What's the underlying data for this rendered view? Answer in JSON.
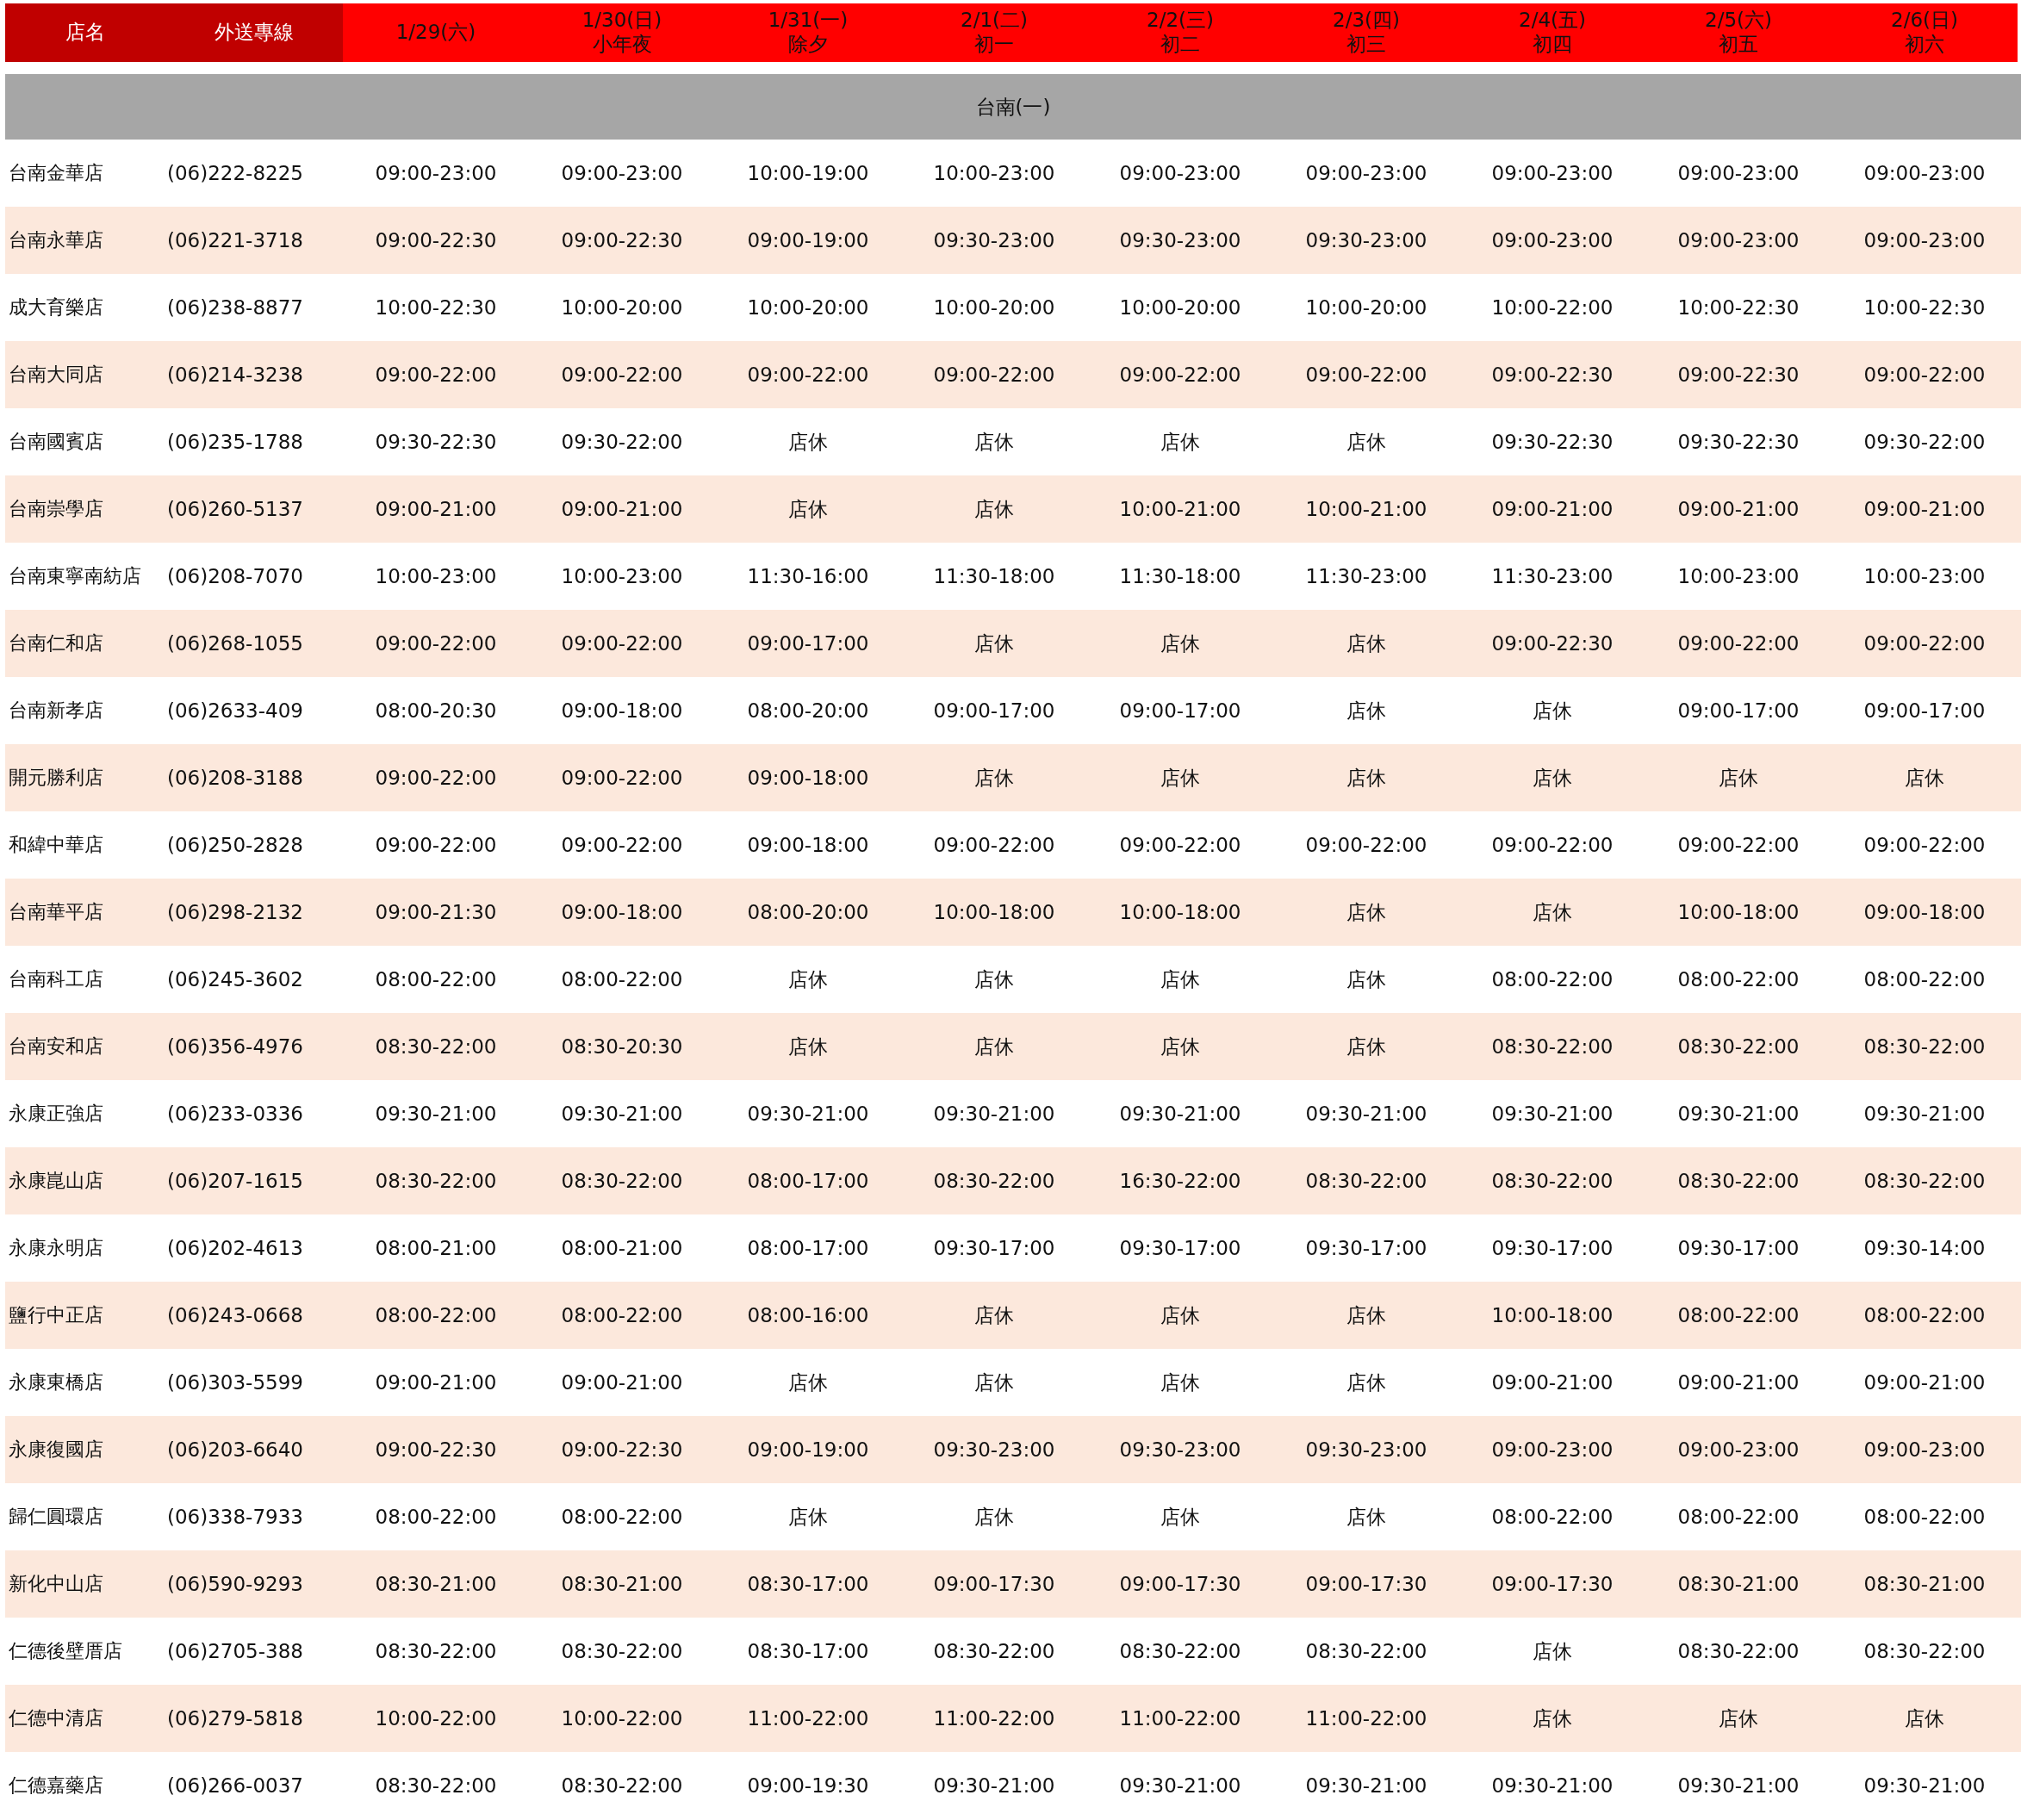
{
  "header": {
    "store": "店名",
    "phone": "外送專線",
    "dates": [
      {
        "date": "1/29(六)"
      },
      {
        "date": "1/30(日)",
        "note": "小年夜"
      },
      {
        "date": "1/31(一)",
        "note": "除夕"
      },
      {
        "date": "2/1(二)",
        "note": "初一"
      },
      {
        "date": "2/2(三)",
        "note": "初二"
      },
      {
        "date": "2/3(四)",
        "note": "初三"
      },
      {
        "date": "2/4(五)",
        "note": "初四"
      },
      {
        "date": "2/5(六)",
        "note": "初五"
      },
      {
        "date": "2/6(日)",
        "note": "初六"
      }
    ]
  },
  "section": "台南(一)",
  "rows": [
    {
      "store": "台南金華店",
      "phone": "(06)222-8225",
      "hours": [
        "09:00-23:00",
        "09:00-23:00",
        "10:00-19:00",
        "10:00-23:00",
        "09:00-23:00",
        "09:00-23:00",
        "09:00-23:00",
        "09:00-23:00",
        "09:00-23:00"
      ]
    },
    {
      "store": "台南永華店",
      "phone": "(06)221-3718",
      "hours": [
        "09:00-22:30",
        "09:00-22:30",
        "09:00-19:00",
        "09:30-23:00",
        "09:30-23:00",
        "09:30-23:00",
        "09:00-23:00",
        "09:00-23:00",
        "09:00-23:00"
      ]
    },
    {
      "store": "成大育樂店",
      "phone": "(06)238-8877",
      "hours": [
        "10:00-22:30",
        "10:00-20:00",
        "10:00-20:00",
        "10:00-20:00",
        "10:00-20:00",
        "10:00-20:00",
        "10:00-22:00",
        "10:00-22:30",
        "10:00-22:30"
      ]
    },
    {
      "store": "台南大同店",
      "phone": "(06)214-3238",
      "hours": [
        "09:00-22:00",
        "09:00-22:00",
        "09:00-22:00",
        "09:00-22:00",
        "09:00-22:00",
        "09:00-22:00",
        "09:00-22:30",
        "09:00-22:30",
        "09:00-22:00"
      ]
    },
    {
      "store": "台南國賓店",
      "phone": "(06)235-1788",
      "hours": [
        "09:30-22:30",
        "09:30-22:00",
        "店休",
        "店休",
        "店休",
        "店休",
        "09:30-22:30",
        "09:30-22:30",
        "09:30-22:00"
      ]
    },
    {
      "store": "台南崇學店",
      "phone": "(06)260-5137",
      "hours": [
        "09:00-21:00",
        "09:00-21:00",
        "店休",
        "店休",
        "10:00-21:00",
        "10:00-21:00",
        "09:00-21:00",
        "09:00-21:00",
        "09:00-21:00"
      ]
    },
    {
      "store": "台南東寧南紡店",
      "phone": "(06)208-7070",
      "hours": [
        "10:00-23:00",
        "10:00-23:00",
        "11:30-16:00",
        "11:30-18:00",
        "11:30-18:00",
        "11:30-23:00",
        "11:30-23:00",
        "10:00-23:00",
        "10:00-23:00"
      ]
    },
    {
      "store": "台南仁和店",
      "phone": "(06)268-1055",
      "hours": [
        "09:00-22:00",
        "09:00-22:00",
        "09:00-17:00",
        "店休",
        "店休",
        "店休",
        "09:00-22:30",
        "09:00-22:00",
        "09:00-22:00"
      ]
    },
    {
      "store": "台南新孝店",
      "phone": "(06)2633-409",
      "hours": [
        "08:00-20:30",
        "09:00-18:00",
        "08:00-20:00",
        "09:00-17:00",
        "09:00-17:00",
        "店休",
        "店休",
        "09:00-17:00",
        "09:00-17:00"
      ]
    },
    {
      "store": "開元勝利店",
      "phone": "(06)208-3188",
      "hours": [
        "09:00-22:00",
        "09:00-22:00",
        "09:00-18:00",
        "店休",
        "店休",
        "店休",
        "店休",
        "店休",
        "店休"
      ]
    },
    {
      "store": "和緯中華店",
      "phone": "(06)250-2828",
      "hours": [
        "09:00-22:00",
        "09:00-22:00",
        "09:00-18:00",
        "09:00-22:00",
        "09:00-22:00",
        "09:00-22:00",
        "09:00-22:00",
        "09:00-22:00",
        "09:00-22:00"
      ]
    },
    {
      "store": "台南華平店",
      "phone": "(06)298-2132",
      "hours": [
        "09:00-21:30",
        "09:00-18:00",
        "08:00-20:00",
        "10:00-18:00",
        "10:00-18:00",
        "店休",
        "店休",
        "10:00-18:00",
        "09:00-18:00"
      ]
    },
    {
      "store": "台南科工店",
      "phone": "(06)245-3602",
      "hours": [
        "08:00-22:00",
        "08:00-22:00",
        "店休",
        "店休",
        "店休",
        "店休",
        "08:00-22:00",
        "08:00-22:00",
        "08:00-22:00"
      ]
    },
    {
      "store": "台南安和店",
      "phone": "(06)356-4976",
      "hours": [
        "08:30-22:00",
        "08:30-20:30",
        "店休",
        "店休",
        "店休",
        "店休",
        "08:30-22:00",
        "08:30-22:00",
        "08:30-22:00"
      ]
    },
    {
      "store": "永康正強店",
      "phone": "(06)233-0336",
      "hours": [
        "09:30-21:00",
        "09:30-21:00",
        "09:30-21:00",
        "09:30-21:00",
        "09:30-21:00",
        "09:30-21:00",
        "09:30-21:00",
        "09:30-21:00",
        "09:30-21:00"
      ]
    },
    {
      "store": "永康崑山店",
      "phone": "(06)207-1615",
      "hours": [
        "08:30-22:00",
        "08:30-22:00",
        "08:00-17:00",
        "08:30-22:00",
        "16:30-22:00",
        "08:30-22:00",
        "08:30-22:00",
        "08:30-22:00",
        "08:30-22:00"
      ]
    },
    {
      "store": "永康永明店",
      "phone": "(06)202-4613",
      "hours": [
        "08:00-21:00",
        "08:00-21:00",
        "08:00-17:00",
        "09:30-17:00",
        "09:30-17:00",
        "09:30-17:00",
        "09:30-17:00",
        "09:30-17:00",
        "09:30-14:00"
      ]
    },
    {
      "store": "鹽行中正店",
      "phone": "(06)243-0668",
      "hours": [
        "08:00-22:00",
        "08:00-22:00",
        "08:00-16:00",
        "店休",
        "店休",
        "店休",
        "10:00-18:00",
        "08:00-22:00",
        "08:00-22:00"
      ]
    },
    {
      "store": "永康東橋店",
      "phone": "(06)303-5599",
      "hours": [
        "09:00-21:00",
        "09:00-21:00",
        "店休",
        "店休",
        "店休",
        "店休",
        "09:00-21:00",
        "09:00-21:00",
        "09:00-21:00"
      ]
    },
    {
      "store": "永康復國店",
      "phone": "(06)203-6640",
      "hours": [
        "09:00-22:30",
        "09:00-22:30",
        "09:00-19:00",
        "09:30-23:00",
        "09:30-23:00",
        "09:30-23:00",
        "09:00-23:00",
        "09:00-23:00",
        "09:00-23:00"
      ]
    },
    {
      "store": "歸仁圓環店",
      "phone": "(06)338-7933",
      "hours": [
        "08:00-22:00",
        "08:00-22:00",
        "店休",
        "店休",
        "店休",
        "店休",
        "08:00-22:00",
        "08:00-22:00",
        "08:00-22:00"
      ]
    },
    {
      "store": "新化中山店",
      "phone": "(06)590-9293",
      "hours": [
        "08:30-21:00",
        "08:30-21:00",
        "08:30-17:00",
        "09:00-17:30",
        "09:00-17:30",
        "09:00-17:30",
        "09:00-17:30",
        "08:30-21:00",
        "08:30-21:00"
      ]
    },
    {
      "store": "仁德後壁厝店",
      "phone": "(06)2705-388",
      "hours": [
        "08:30-22:00",
        "08:30-22:00",
        "08:30-17:00",
        "08:30-22:00",
        "08:30-22:00",
        "08:30-22:00",
        "店休",
        "08:30-22:00",
        "08:30-22:00"
      ]
    },
    {
      "store": "仁德中清店",
      "phone": "(06)279-5818",
      "hours": [
        "10:00-22:00",
        "10:00-22:00",
        "11:00-22:00",
        "11:00-22:00",
        "11:00-22:00",
        "11:00-22:00",
        "店休",
        "店休",
        "店休"
      ]
    },
    {
      "store": "仁德嘉藥店",
      "phone": "(06)266-0037",
      "hours": [
        "08:30-22:00",
        "08:30-22:00",
        "09:00-19:30",
        "09:30-21:00",
        "09:30-21:00",
        "09:30-21:00",
        "09:30-21:00",
        "09:30-21:00",
        "09:30-21:00"
      ]
    }
  ]
}
